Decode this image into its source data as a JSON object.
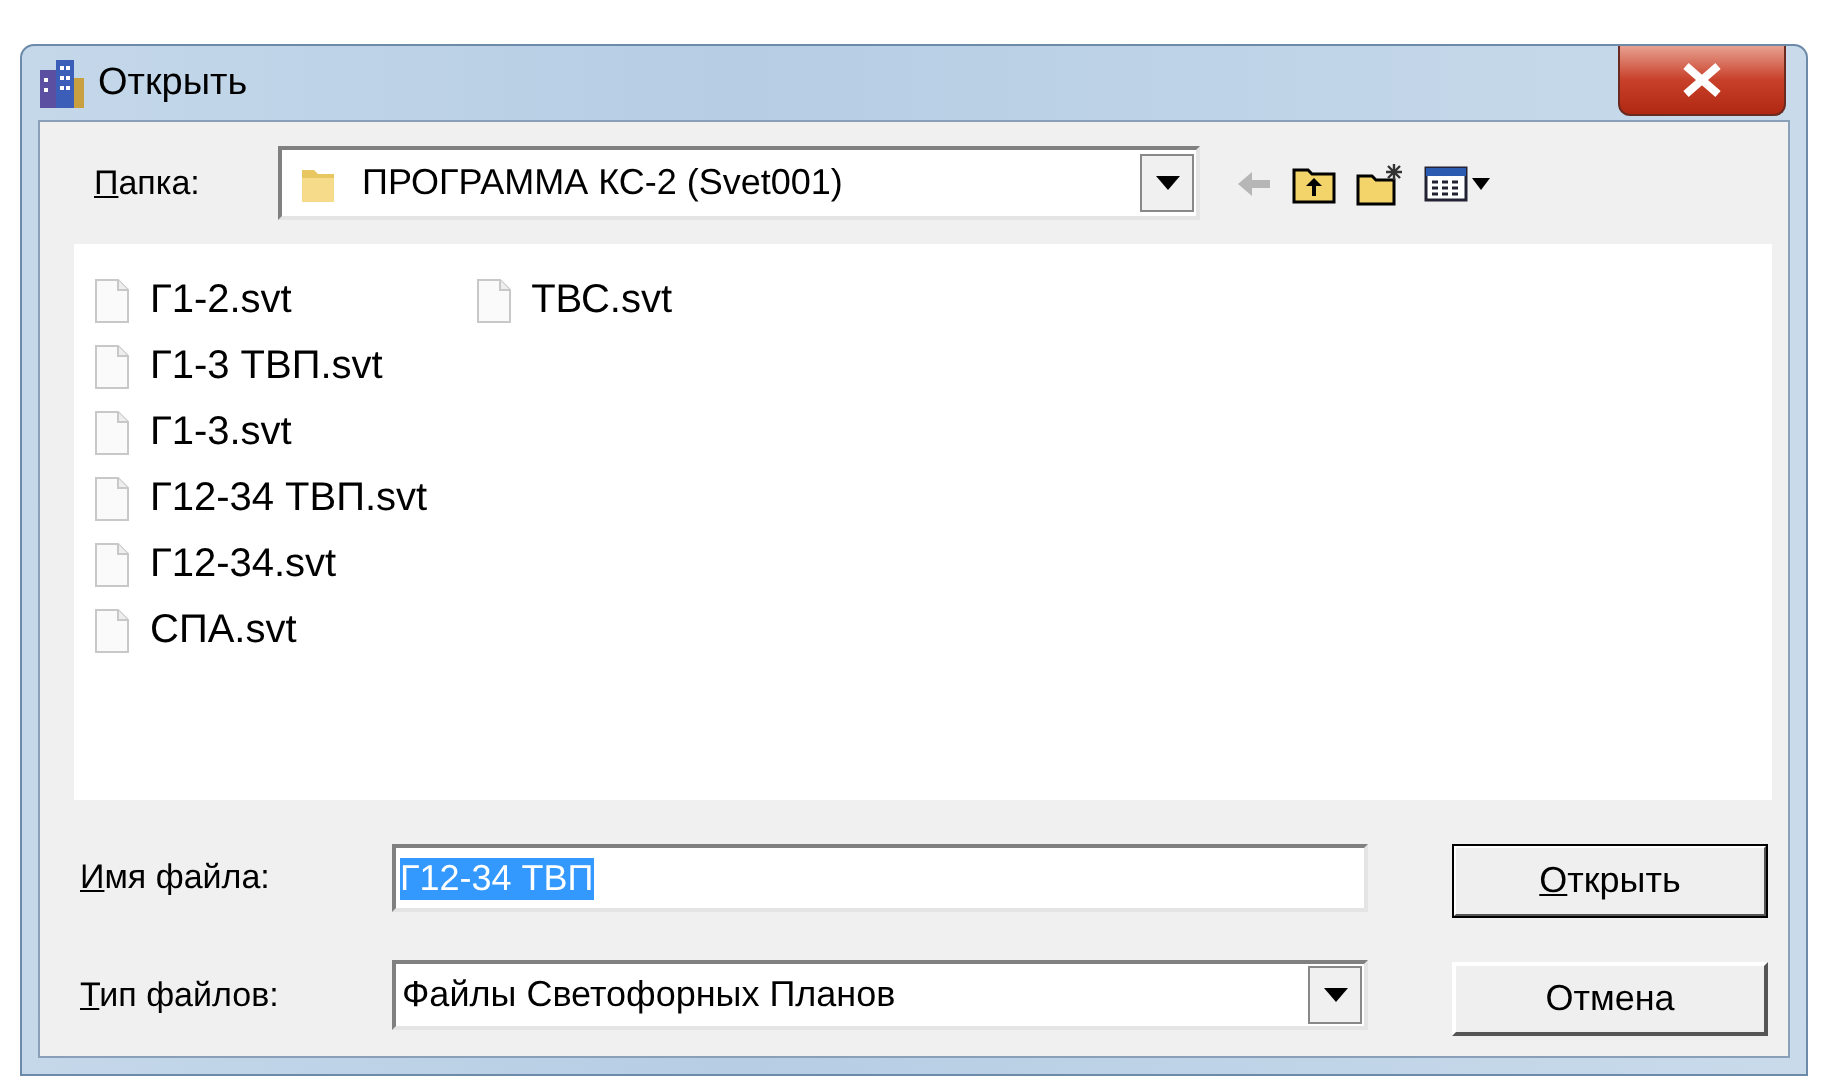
{
  "window": {
    "title": "Открыть"
  },
  "folder": {
    "label": "Папка:",
    "label_underlined": true,
    "value": "ПРОГРАММА КС-2 (Svet001)"
  },
  "toolbar": [
    {
      "kind": "back",
      "disabled": true
    },
    {
      "kind": "up"
    },
    {
      "kind": "new-folder"
    },
    {
      "kind": "view-menu"
    }
  ],
  "files": [
    {
      "name": "Г1-2.svt",
      "selected": false
    },
    {
      "name": "Г1-3 ТВП.svt",
      "selected": false
    },
    {
      "name": "Г1-3.svt",
      "selected": false
    },
    {
      "name": "Г12-34 ТВП.svt",
      "selected": false
    },
    {
      "name": "Г12-34.svt",
      "selected": false
    },
    {
      "name": "СПА.svt",
      "selected": false
    },
    {
      "name": "ТВС.svt",
      "selected": false
    }
  ],
  "file_name": {
    "label": "Имя файла:",
    "label_underlined": true,
    "value": "Г12-34 ТВП",
    "value_selected": true
  },
  "file_type": {
    "label": "Тип файлов:",
    "label_underlined": true,
    "value": "Файлы Светофорных Планов"
  },
  "buttons": [
    {
      "label": "Открыть",
      "underlined": true,
      "default": true
    },
    {
      "label": "Отмена",
      "underlined": false,
      "default": false
    }
  ]
}
